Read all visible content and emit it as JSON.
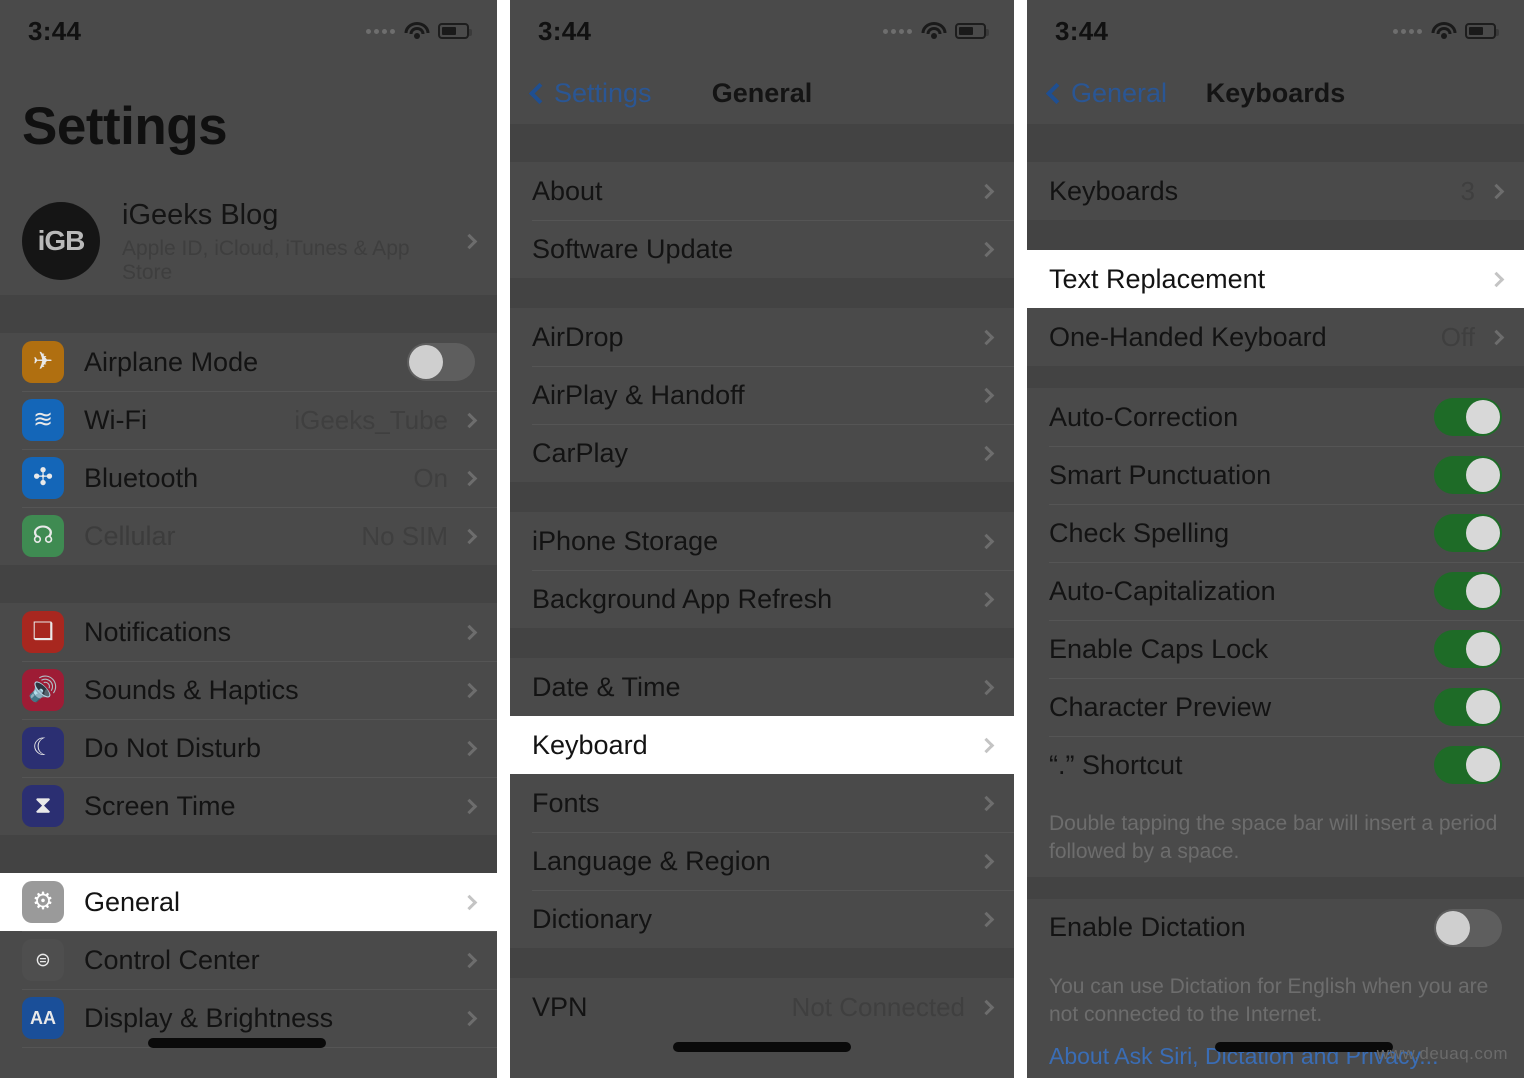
{
  "statusbar": {
    "time": "3:44"
  },
  "panel1": {
    "title": "Settings",
    "account": {
      "avatar_text": "iGB",
      "name": "iGeeks Blog",
      "subtitle": "Apple ID, iCloud, iTunes & App Store"
    },
    "group_connectivity": [
      {
        "label": "Airplane Mode",
        "icon": "airplane-icon",
        "icon_color": "#b06f10",
        "control": "toggle",
        "toggle_on": false
      },
      {
        "label": "Wi-Fi",
        "icon": "wifi-icon",
        "icon_color": "#1466b8",
        "value": "iGeeks_Tube"
      },
      {
        "label": "Bluetooth",
        "icon": "bluetooth-icon",
        "icon_color": "#1466b8",
        "value": "On"
      },
      {
        "label": "Cellular",
        "icon": "cellular-icon",
        "icon_color": "#3f8b52",
        "value": "No SIM"
      }
    ],
    "group_alerts": [
      {
        "label": "Notifications",
        "icon": "notifications-icon",
        "icon_color": "#a8271f"
      },
      {
        "label": "Sounds & Haptics",
        "icon": "sounds-icon",
        "icon_color": "#9e1c35"
      },
      {
        "label": "Do Not Disturb",
        "icon": "moon-icon",
        "icon_color": "#2b2f72"
      },
      {
        "label": "Screen Time",
        "icon": "hourglass-icon",
        "icon_color": "#2b2f72"
      }
    ],
    "group_system": [
      {
        "label": "General",
        "icon": "gear-icon",
        "icon_color": "#9a9a9a",
        "highlighted": true
      },
      {
        "label": "Control Center",
        "icon": "control-center-icon",
        "icon_color": "#4e4e4e"
      },
      {
        "label": "Display & Brightness",
        "icon": "display-icon",
        "icon_color": "#1a4f99"
      }
    ]
  },
  "panel2": {
    "back_label": "Settings",
    "title": "General",
    "group_a": [
      {
        "label": "About"
      },
      {
        "label": "Software Update"
      }
    ],
    "group_b": [
      {
        "label": "AirDrop"
      },
      {
        "label": "AirPlay & Handoff"
      },
      {
        "label": "CarPlay"
      }
    ],
    "group_c": [
      {
        "label": "iPhone Storage"
      },
      {
        "label": "Background App Refresh"
      }
    ],
    "group_d": [
      {
        "label": "Date & Time"
      }
    ],
    "group_keyboard": [
      {
        "label": "Keyboard",
        "highlighted": true
      }
    ],
    "group_e": [
      {
        "label": "Fonts"
      },
      {
        "label": "Language & Region"
      },
      {
        "label": "Dictionary"
      }
    ],
    "group_f": [
      {
        "label": "VPN",
        "value": "Not Connected"
      }
    ]
  },
  "panel3": {
    "back_label": "General",
    "title": "Keyboards",
    "group_a": [
      {
        "label": "Keyboards",
        "value": "3"
      }
    ],
    "group_text_replacement": [
      {
        "label": "Text Replacement",
        "highlighted": true
      }
    ],
    "group_b": [
      {
        "label": "One-Handed Keyboard",
        "value": "Off"
      }
    ],
    "group_toggles": [
      {
        "label": "Auto-Correction",
        "toggle_on": true
      },
      {
        "label": "Smart Punctuation",
        "toggle_on": true
      },
      {
        "label": "Check Spelling",
        "toggle_on": true
      },
      {
        "label": "Auto-Capitalization",
        "toggle_on": true
      },
      {
        "label": "Enable Caps Lock",
        "toggle_on": true
      },
      {
        "label": "Character Preview",
        "toggle_on": true
      },
      {
        "label": "“.” Shortcut",
        "toggle_on": true
      }
    ],
    "footnote_shortcut": "Double tapping the space bar will insert a period followed by a space.",
    "group_dictation": [
      {
        "label": "Enable Dictation",
        "toggle_on": false
      }
    ],
    "footnote_dictation": "You can use Dictation for English when you are not connected to the Internet.",
    "privacy_link": "About Ask Siri, Dictation and Privacy..."
  },
  "watermark": "www.deuaq.com",
  "colors": {
    "dim_background": "#4a4a4a",
    "highlight_background": "#ffffff",
    "toggle_on": "#1e6b27",
    "link_blue": "#3a6db5",
    "back_blue": "#2a5694"
  }
}
